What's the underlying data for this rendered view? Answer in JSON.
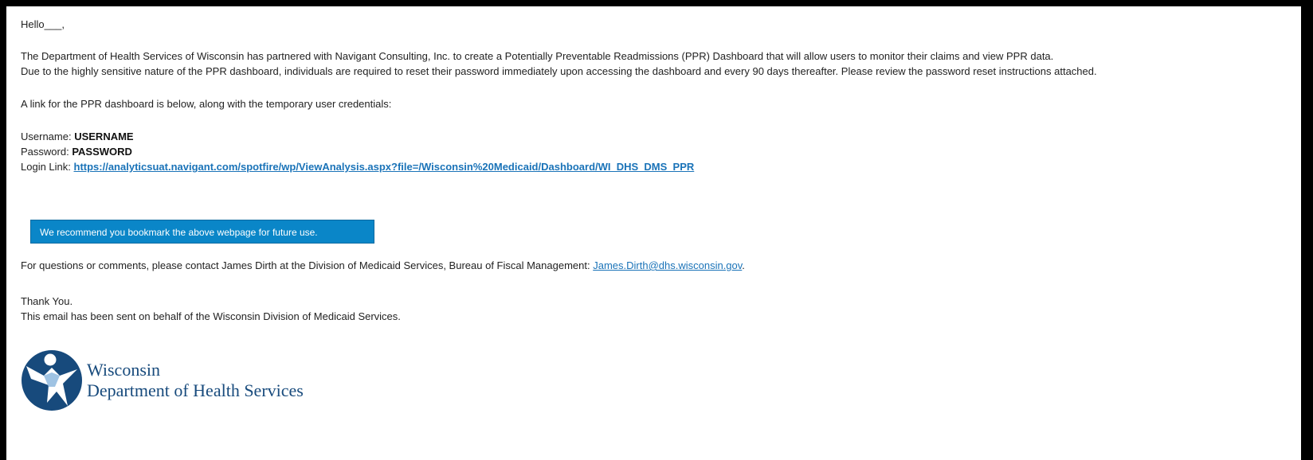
{
  "email": {
    "greeting": "Hello___,",
    "intro_line1": "The Department of Health Services of Wisconsin has partnered with Navigant Consulting, Inc. to create a Potentially Preventable Readmissions (PPR) Dashboard that will allow users to monitor their claims and view PPR data.",
    "intro_line2": "Due to the highly sensitive nature of the PPR dashboard, individuals are required to reset their password immediately upon accessing the dashboard and every 90 days thereafter. Please review the password reset instructions attached.",
    "link_intro": "A link for the PPR dashboard is below, along with the temporary user credentials:",
    "username_label": "Username: ",
    "username_value": "USERNAME",
    "password_label": "Password: ",
    "password_value": "PASSWORD",
    "login_label": "Login Link: ",
    "login_url": "https://analyticsuat.navigant.com/spotfire/wp/ViewAnalysis.aspx?file=/Wisconsin%20Medicaid/Dashboard/WI_DHS_DMS_PPR",
    "recommend_text": "We recommend you bookmark the above webpage for future use.",
    "questions_text": "For questions or comments, please contact James Dirth at the Division of Medicaid Services, Bureau of Fiscal Management: ",
    "contact_email": "James.Dirth@dhs.wisconsin.gov",
    "questions_end": ".",
    "thanks": "Thank You.",
    "sent_on_behalf": "This email has been sent on behalf of the Wisconsin Division of Medicaid Services."
  },
  "logo": {
    "icon": "wisconsin-dhs-figure-icon",
    "line1": "Wisconsin",
    "line2": "Department of Health Services",
    "brand_color": "#174a7c"
  },
  "colors": {
    "link": "#1a73b8",
    "banner": "#0a86c8"
  }
}
